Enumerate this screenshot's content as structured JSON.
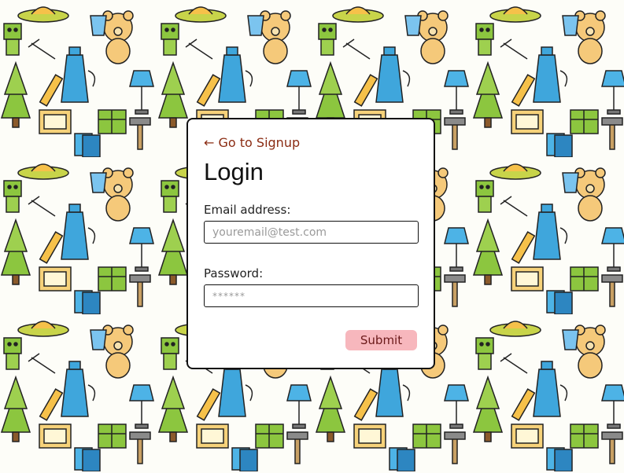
{
  "login": {
    "back_link": "← Go to Signup",
    "title": "Login",
    "email_label": "Email address:",
    "email_placeholder": "youremail@test.com",
    "password_label": "Password:",
    "password_placeholder": "******",
    "submit_label": "Submit"
  },
  "colors": {
    "link": "#8a2b12",
    "submit_bg": "#f7b7bd",
    "card_border": "#111111"
  },
  "background": {
    "pattern_icons": [
      "teddy-bear-icon",
      "ufo-icon",
      "fir-tree-icon",
      "teapot-icon",
      "lamp-icon",
      "robot-icon",
      "gift-icon",
      "pencil-icon",
      "hammer-icon",
      "cup-icon",
      "book-icon",
      "calculator-icon",
      "cards-icon",
      "fork-icon",
      "tube-icon"
    ]
  }
}
